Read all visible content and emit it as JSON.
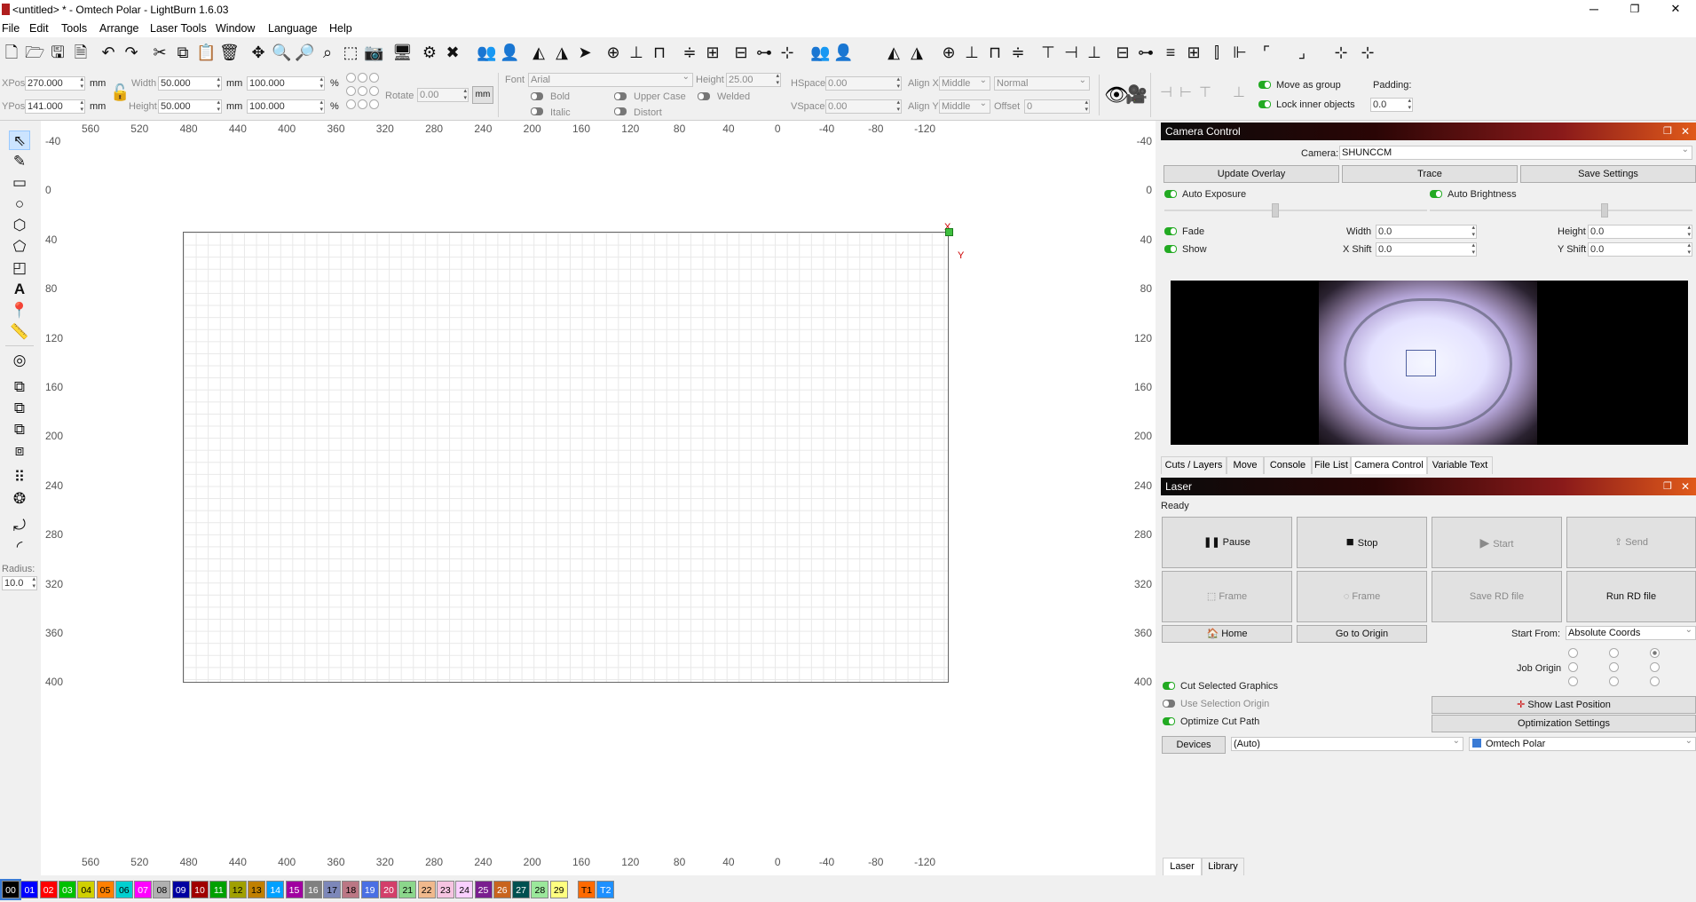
{
  "window": {
    "title": "<untitled> * - Omtech Polar - LightBurn 1.6.03",
    "minimize": "─",
    "maximize": "❐",
    "close": "✕"
  },
  "menu": [
    "File",
    "Edit",
    "Tools",
    "Arrange",
    "Laser Tools",
    "Window",
    "Language",
    "Help"
  ],
  "toolbar": {
    "icons": [
      "new-file-icon",
      "open-folder-icon",
      "save-icon",
      "save-as-icon",
      "undo-icon",
      "redo-icon",
      "cut-icon",
      "copy-icon",
      "paste-icon",
      "delete-icon",
      "move-icon",
      "zoom-in-icon",
      "zoom-out-icon",
      "zoom-fit-icon",
      "zoom-frame-icon",
      "camera-capture-icon",
      "monitor-icon",
      "settings-icon",
      "tools-icon",
      "group-icon",
      "ungroup-icon",
      "mirror-h-icon",
      "mirror-v-icon",
      "rotate-icon",
      "align-center-icon",
      "align-left-icon",
      "align-right-icon",
      "align-top-icon",
      "align-middle-icon",
      "align-bottom-icon",
      "distribute-h-icon",
      "distribute-v-icon"
    ]
  },
  "props": {
    "xpos_label": "XPos",
    "xpos": "270.000",
    "ypos_label": "YPos",
    "ypos": "141.000",
    "unit": "mm",
    "width_label": "Width",
    "width": "50.000",
    "height_label": "Height",
    "height": "50.000",
    "w_pct": "100.000",
    "h_pct": "100.000",
    "pct": "%",
    "rotate_label": "Rotate",
    "rotate": "0.00",
    "mm_btn": "mm",
    "font_label": "Font",
    "font": "Arial",
    "fheight_label": "Height",
    "fheight": "25.00",
    "hspace_label": "HSpace",
    "hspace": "0.00",
    "vspace_label": "VSpace",
    "vspace": "0.00",
    "alignx_label": "Align X",
    "alignx": "Middle",
    "aligny_label": "Align Y",
    "aligny": "Middle",
    "normal": "Normal",
    "offset_label": "Offset",
    "offset": "0",
    "bold": "Bold",
    "italic": "Italic",
    "upper": "Upper Case",
    "distort": "Distort",
    "welded": "Welded",
    "move_group": "Move as group",
    "lock_inner": "Lock inner objects",
    "padding_label": "Padding:",
    "padding": "0.0"
  },
  "left_tools": {
    "radius_label": "Radius:",
    "radius": "10.0"
  },
  "ruler": {
    "top": [
      "560",
      "520",
      "480",
      "440",
      "400",
      "360",
      "320",
      "280",
      "240",
      "200",
      "160",
      "120",
      "80",
      "40",
      "0",
      "-40",
      "-80",
      "-120"
    ],
    "left": [
      "-40",
      "0",
      "40",
      "80",
      "120",
      "160",
      "200",
      "240",
      "280",
      "320",
      "360",
      "400"
    ],
    "x_marker": "X",
    "y_marker": "Y"
  },
  "camera": {
    "title": "Camera Control",
    "camera_label": "Camera:",
    "camera": "SHUNCCM",
    "update_overlay": "Update Overlay",
    "trace": "Trace",
    "save_settings": "Save Settings",
    "auto_exposure": "Auto Exposure",
    "auto_brightness": "Auto Brightness",
    "fade": "Fade",
    "show": "Show",
    "width_label": "Width",
    "width": "0.0",
    "height_label": "Height",
    "height": "0.0",
    "xshift_label": "X Shift",
    "xshift": "0.0",
    "yshift_label": "Y Shift",
    "yshift": "0.0"
  },
  "tabs": [
    "Cuts / Layers",
    "Move",
    "Console",
    "File List",
    "Camera Control",
    "Variable Text"
  ],
  "laser": {
    "title": "Laser",
    "status": "Ready",
    "pause": "Pause",
    "stop": "Stop",
    "start": "Start",
    "send": "Send",
    "frame1": "Frame",
    "frame2": "Frame",
    "save_rd": "Save RD file",
    "run_rd": "Run RD file",
    "home": "Home",
    "go_origin": "Go to Origin",
    "start_from_label": "Start From:",
    "start_from": "Absolute Coords",
    "job_origin": "Job Origin",
    "cut_selected": "Cut Selected Graphics",
    "use_selection": "Use Selection Origin",
    "optimize_cut": "Optimize Cut Path",
    "show_last": "Show Last Position",
    "opt_settings": "Optimization Settings",
    "devices": "Devices",
    "auto": "(Auto)",
    "device": "Omtech Polar"
  },
  "bottom_tabs": [
    "Laser",
    "Library"
  ],
  "palette": [
    {
      "label": "00",
      "color": "#000000",
      "text": "#ffffff"
    },
    {
      "label": "01",
      "color": "#0000ff",
      "text": "#ffffff"
    },
    {
      "label": "02",
      "color": "#ff0000",
      "text": "#ffffff"
    },
    {
      "label": "03",
      "color": "#00c000",
      "text": "#ffffff"
    },
    {
      "label": "04",
      "color": "#d0d000",
      "text": "#000000"
    },
    {
      "label": "05",
      "color": "#ff8000",
      "text": "#000000"
    },
    {
      "label": "06",
      "color": "#00d0d0",
      "text": "#000000"
    },
    {
      "label": "07",
      "color": "#ff00ff",
      "text": "#ffffff"
    },
    {
      "label": "08",
      "color": "#b0b0b0",
      "text": "#000000"
    },
    {
      "label": "09",
      "color": "#0000a0",
      "text": "#ffffff"
    },
    {
      "label": "10",
      "color": "#a00000",
      "text": "#ffffff"
    },
    {
      "label": "11",
      "color": "#00a000",
      "text": "#ffffff"
    },
    {
      "label": "12",
      "color": "#a0a000",
      "text": "#000000"
    },
    {
      "label": "13",
      "color": "#c08000",
      "text": "#000000"
    },
    {
      "label": "14",
      "color": "#00a0ff",
      "text": "#ffffff"
    },
    {
      "label": "15",
      "color": "#a000a0",
      "text": "#ffffff"
    },
    {
      "label": "16",
      "color": "#808080",
      "text": "#ffffff"
    },
    {
      "label": "17",
      "color": "#7d87b9",
      "text": "#000000"
    },
    {
      "label": "18",
      "color": "#bb7784",
      "text": "#000000"
    },
    {
      "label": "19",
      "color": "#4a6fe3",
      "text": "#ffffff"
    },
    {
      "label": "20",
      "color": "#d33f6a",
      "text": "#ffffff"
    },
    {
      "label": "21",
      "color": "#8cd78c",
      "text": "#000000"
    },
    {
      "label": "22",
      "color": "#f0b98d",
      "text": "#000000"
    },
    {
      "label": "23",
      "color": "#f6c4e1",
      "text": "#000000"
    },
    {
      "label": "24",
      "color": "#fad0ff",
      "text": "#000000"
    },
    {
      "label": "25",
      "color": "#7a1f8f",
      "text": "#ffffff"
    },
    {
      "label": "26",
      "color": "#c8641e",
      "text": "#ffffff"
    },
    {
      "label": "27",
      "color": "#005050",
      "text": "#ffffff"
    },
    {
      "label": "28",
      "color": "#9be89b",
      "text": "#000000"
    },
    {
      "label": "29",
      "color": "#ffff80",
      "text": "#000000"
    },
    {
      "label": "T1",
      "color": "#ff6a00",
      "text": "#000000"
    },
    {
      "label": "T2",
      "color": "#1e90ff",
      "text": "#ffffff"
    }
  ]
}
